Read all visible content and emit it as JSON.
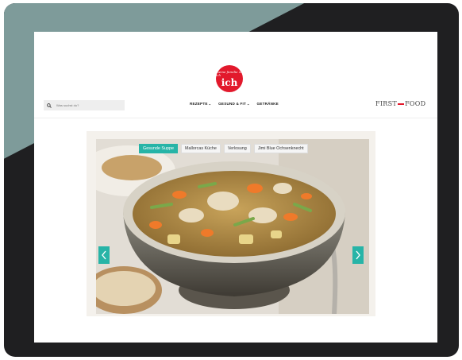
{
  "logo": {
    "line1": "meine familie & ich",
    "line2": "ich"
  },
  "search": {
    "placeholder": "Was suchst du?"
  },
  "nav": {
    "items": [
      {
        "label": "REZEPTE",
        "dropdown": true
      },
      {
        "label": "GESUND & FIT",
        "dropdown": true
      },
      {
        "label": "GETRÄNKE",
        "dropdown": false
      }
    ]
  },
  "brand": {
    "left": "FIRST",
    "right": "FOOD"
  },
  "slider": {
    "tags": [
      {
        "label": "Gesunde Suppe",
        "active": true
      },
      {
        "label": "Mallorcas Küche",
        "active": false
      },
      {
        "label": "Verlosung",
        "active": false
      },
      {
        "label": "Jimi Blue Ochsenknecht",
        "active": false
      }
    ],
    "accent": "#27b4a7"
  },
  "colors": {
    "brand_red": "#e2192c",
    "frame_teal": "#7e9b9a",
    "frame_dark": "#1f1f21"
  }
}
